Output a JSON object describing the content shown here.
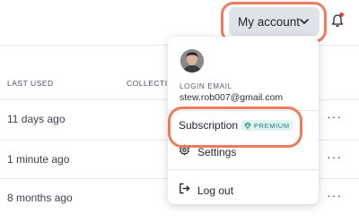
{
  "header": {
    "account_button_label": "My account",
    "account_icon": "chevron-down-icon",
    "notification_icon": "bell-icon"
  },
  "table": {
    "columns": [
      "LAST USED",
      "COLLECTIO"
    ],
    "rows": [
      {
        "last_used": "11 days ago"
      },
      {
        "last_used": "1 minute ago"
      },
      {
        "last_used": "8 months ago"
      }
    ],
    "row_menu_icon": "more-dots-icon"
  },
  "account_menu": {
    "login_label": "LOGIN EMAIL",
    "email": "stew.rob007@gmail.com",
    "subscription_label": "Subscription",
    "premium_badge": "PREMIUM",
    "settings_label": "Settings",
    "logout_label": "Log out"
  },
  "colors": {
    "highlight": "#ef7a5c",
    "badge_bg": "#dff3f1",
    "badge_text": "#1c7f79",
    "notification_dot": "#e2403a"
  }
}
